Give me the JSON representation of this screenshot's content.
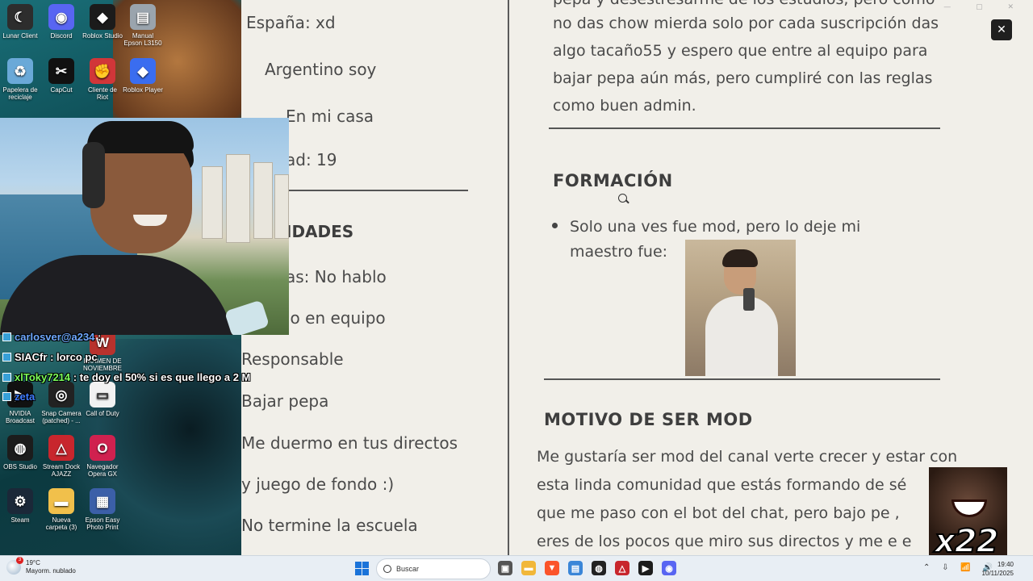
{
  "desktop": {
    "icons": [
      {
        "label": "Lunar Client",
        "icon": "lunar-client-icon",
        "color": "#2d2d2d",
        "glyph": "☾"
      },
      {
        "label": "Discord",
        "icon": "discord-icon",
        "color": "#5865f2",
        "glyph": "◉"
      },
      {
        "label": "Roblox Studio",
        "icon": "roblox-studio-icon",
        "color": "#1b1b1b",
        "glyph": "◆"
      },
      {
        "label": "Manual Epson L3150",
        "icon": "epson-manual-icon",
        "color": "#9aa4ad",
        "glyph": "▤"
      },
      {
        "label": "Papelera de reciclaje",
        "icon": "recycle-bin-icon",
        "color": "#6aa9d8",
        "glyph": "♻"
      },
      {
        "label": "CapCut",
        "icon": "capcut-icon",
        "color": "#111111",
        "glyph": "✂"
      },
      {
        "label": "Cliente de Riot",
        "icon": "riot-client-icon",
        "color": "#d13639",
        "glyph": "✊"
      },
      {
        "label": "Roblox Player",
        "icon": "roblox-player-icon",
        "color": "#3a6df0",
        "glyph": "◆"
      },
      {
        "label": "EXAMEN DE NOVIEMBRE",
        "icon": "document-icon",
        "color": "#b8322d",
        "glyph": "W"
      },
      {
        "label": "NVIDIA Broadcast",
        "icon": "nvidia-broadcast-icon",
        "color": "#111111",
        "glyph": "▶"
      },
      {
        "label": "Snap Camera (patched) - ...",
        "icon": "snap-camera-icon",
        "color": "#222222",
        "glyph": "◎"
      },
      {
        "label": "Call of Duty",
        "icon": "call-of-duty-icon",
        "color": "#f2f2f2",
        "glyph": "▭"
      },
      {
        "label": "OBS Studio",
        "icon": "obs-studio-icon",
        "color": "#1c1c1c",
        "glyph": "◍"
      },
      {
        "label": "Stream Dock AJAZZ",
        "icon": "stream-dock-icon",
        "color": "#c8262d",
        "glyph": "△"
      },
      {
        "label": "Navegador Opera GX",
        "icon": "opera-gx-icon",
        "color": "#d0214f",
        "glyph": "O"
      },
      {
        "label": "Steam",
        "icon": "steam-icon",
        "color": "#1b2838",
        "glyph": "⚙"
      },
      {
        "label": "Nueva carpeta (3)",
        "icon": "folder-icon",
        "color": "#f1c04b",
        "glyph": "▬"
      },
      {
        "label": "Epson Easy Photo Print",
        "icon": "epson-photo-print-icon",
        "color": "#3b5fa8",
        "glyph": "▦"
      }
    ]
  },
  "doc": {
    "left_column": [
      "España: xd",
      "Argentino soy",
      "En mi casa",
      "ad: 19",
      "IDADES",
      "as: No hablo",
      "jo en equipo",
      "Responsable",
      "Bajar pepa",
      "Me duermo en tus directos",
      "y juego de fondo :)",
      "No termine la escuela"
    ],
    "right_top_lines": [
      "pepa y desestresarme de los estudios, pero como",
      "no das chow mierda solo por cada suscripción das",
      "algo tacaño55 y espero que entre al equipo para",
      "bajar pepa aún más, pero cumpliré con las reglas",
      "como buen admin."
    ],
    "formacion_heading": "FORMACIÓN",
    "formacion_bullet_line1": "Solo una ves fue mod, pero lo deje mi",
    "formacion_bullet_line2": "maestro fue:",
    "motivo_heading": "MOTIVO DE SER MOD",
    "motivo_lines": [
      "Me gustaría ser mod del canal verte crecer y estar con",
      "esta linda comunidad que estás formando de         sé",
      "que me paso con el bot del chat, pero bajo pe          ,",
      "eres de los pocos que miro sus directos y me e          e"
    ],
    "close_glyph": "✕"
  },
  "chat": [
    {
      "user": "carlosver@a234",
      "text": ":",
      "color": "#6fa8ff"
    },
    {
      "user": "SIACfr",
      "text": ": lorco pc",
      "color": "#ffffff"
    },
    {
      "user": "xlToky7214",
      "text": ": te doy el 50% si es que llego a 2 M",
      "color": "#7cff5a"
    },
    {
      "user": "zeta",
      "text": "",
      "color": "#3f7cff"
    }
  ],
  "reaction": {
    "count": "x22"
  },
  "taskbar": {
    "weather_temp": "19°C",
    "weather_desc": "Mayorm. nublado",
    "weather_badge": "3",
    "search_placeholder": "Buscar",
    "time": "19:40",
    "date": "10/11/2025",
    "apps": [
      {
        "icon": "task-view-icon",
        "color": "#555555",
        "glyph": "▣"
      },
      {
        "icon": "file-explorer-icon",
        "color": "#f1b73a",
        "glyph": "▬"
      },
      {
        "icon": "brave-icon",
        "color": "#fb542b",
        "glyph": "▼"
      },
      {
        "icon": "notepad-icon",
        "color": "#3a86d8",
        "glyph": "▤"
      },
      {
        "icon": "obs-studio-icon",
        "color": "#222222",
        "glyph": "◍"
      },
      {
        "icon": "stream-dock-icon",
        "color": "#c8262d",
        "glyph": "△"
      },
      {
        "icon": "nvidia-icon",
        "color": "#1c1c1c",
        "glyph": "▶"
      },
      {
        "icon": "discord-icon",
        "color": "#5865f2",
        "glyph": "◉"
      }
    ]
  }
}
